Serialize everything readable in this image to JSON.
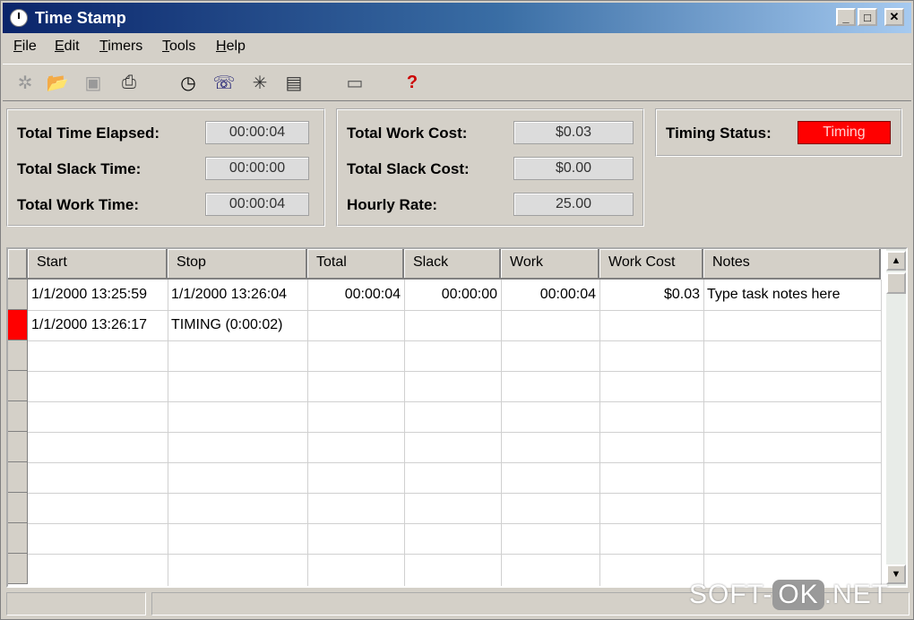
{
  "window": {
    "title": "Time Stamp",
    "minimize": "_",
    "maximize": "□",
    "close": "✕"
  },
  "menu": [
    "File",
    "Edit",
    "Timers",
    "Tools",
    "Help"
  ],
  "toolbar": [
    "new-icon",
    "open-icon",
    "save-icon",
    "print-icon",
    "clock-icon",
    "phone-icon",
    "sun-icon",
    "report-icon",
    "window-icon",
    "help-icon"
  ],
  "summary": {
    "total_time_elapsed_label": "Total Time Elapsed:",
    "total_time_elapsed": "00:00:04",
    "total_slack_time_label": "Total Slack Time:",
    "total_slack_time": "00:00:00",
    "total_work_time_label": "Total Work Time:",
    "total_work_time": "00:00:04",
    "total_work_cost_label": "Total Work Cost:",
    "total_work_cost": "$0.03",
    "total_slack_cost_label": "Total Slack Cost:",
    "total_slack_cost": "$0.00",
    "hourly_rate_label": "Hourly Rate:",
    "hourly_rate": "25.00",
    "timing_status_label": "Timing Status:",
    "timing_status": "Timing"
  },
  "table": {
    "columns": [
      "Start",
      "Stop",
      "Total",
      "Slack",
      "Work",
      "Work Cost",
      "Notes"
    ],
    "rows": [
      [
        "1/1/2000 13:25:59",
        "1/1/2000 13:26:04",
        "00:00:04",
        "00:00:00",
        "00:00:04",
        "$0.03",
        "Type task notes here"
      ],
      [
        "1/1/2000 13:26:17",
        "TIMING (0:00:02)",
        "",
        "",
        "",
        "",
        ""
      ]
    ]
  },
  "watermark": {
    "left": "SOFT-",
    "ok": "OK",
    "right": ".NET"
  },
  "colors": {
    "timing_red": "#ff0000",
    "title_blue": "#0a246a"
  }
}
